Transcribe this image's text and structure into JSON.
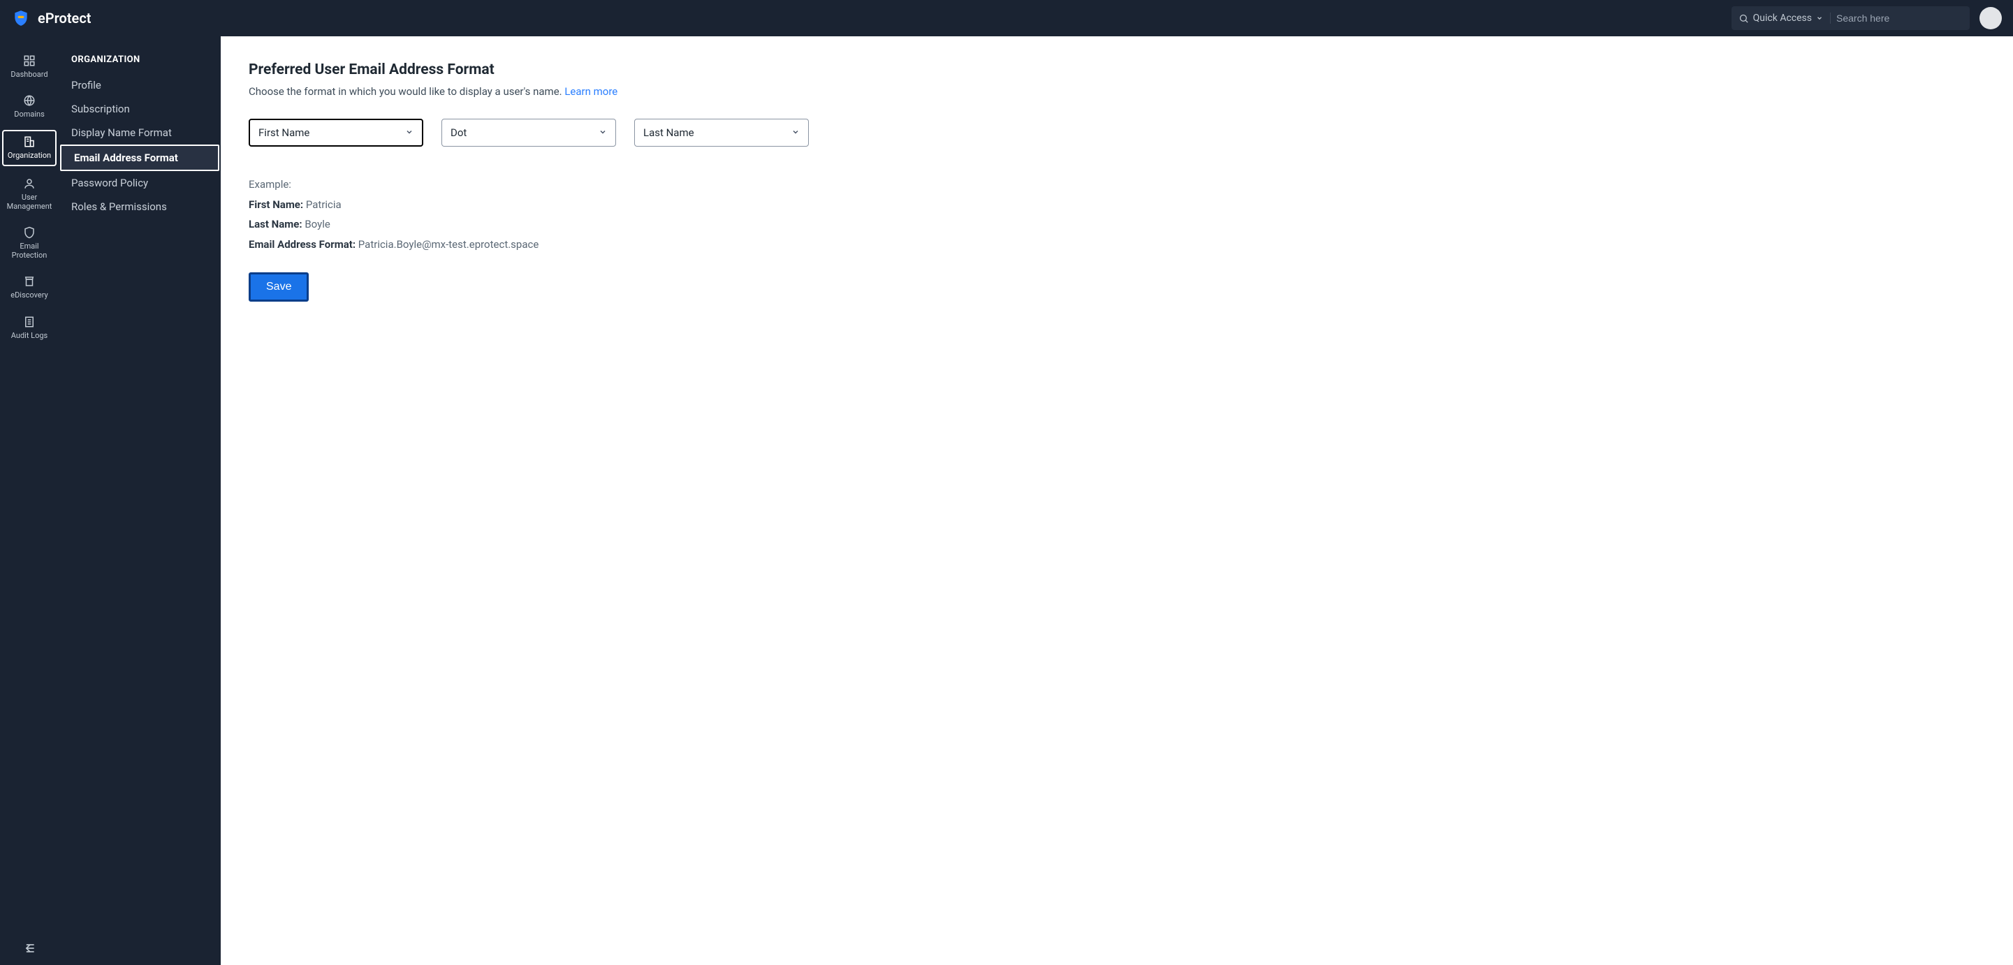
{
  "header": {
    "brand": "eProtect",
    "quick_access": "Quick Access",
    "search_placeholder": "Search here"
  },
  "rail": {
    "items": [
      {
        "id": "dashboard",
        "label": "Dashboard",
        "icon": "dashboard-icon"
      },
      {
        "id": "domains",
        "label": "Domains",
        "icon": "globe-icon"
      },
      {
        "id": "organization",
        "label": "Organization",
        "icon": "building-icon",
        "active": true
      },
      {
        "id": "user-management",
        "label": "User Management",
        "icon": "person-icon"
      },
      {
        "id": "email-protection",
        "label": "Email Protection",
        "icon": "shield-icon"
      },
      {
        "id": "ediscovery",
        "label": "eDiscovery",
        "icon": "archive-icon"
      },
      {
        "id": "audit-logs",
        "label": "Audit Logs",
        "icon": "log-icon"
      }
    ]
  },
  "subnav": {
    "title": "Organization",
    "items": [
      {
        "label": "Profile"
      },
      {
        "label": "Subscription"
      },
      {
        "label": "Display Name Format"
      },
      {
        "label": "Email Address Format",
        "active": true
      },
      {
        "label": "Password Policy"
      },
      {
        "label": "Roles & Permissions"
      }
    ]
  },
  "main": {
    "title": "Preferred User Email Address Format",
    "description": "Choose the format in which you would like to display a user's name. ",
    "learn_more": "Learn more",
    "selects": {
      "first": "First Name",
      "separator": "Dot",
      "last": "Last Name"
    },
    "example": {
      "heading": "Example:",
      "first_label": "First Name:",
      "first_value": "Patricia",
      "last_label": "Last Name:",
      "last_value": "Boyle",
      "format_label": "Email Address Format:",
      "format_value": "Patricia.Boyle@mx-test.eprotect.space"
    },
    "save": "Save"
  }
}
